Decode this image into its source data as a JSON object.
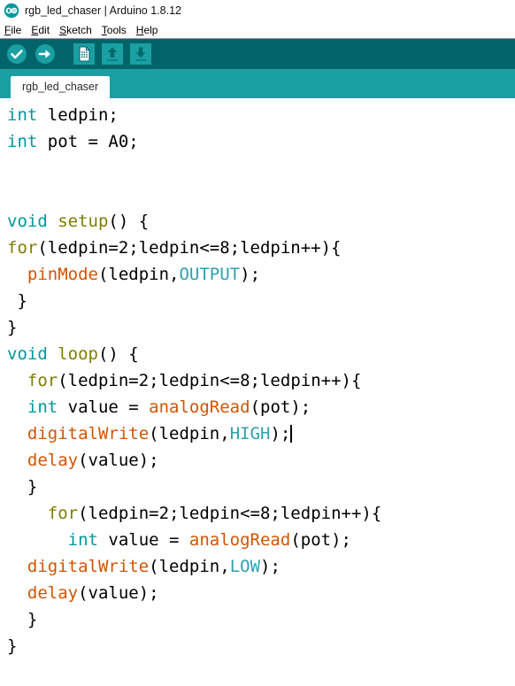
{
  "window": {
    "title": "rgb_led_chaser | Arduino 1.8.12",
    "logo_icon": "arduino-infinity-logo"
  },
  "menubar": {
    "items": [
      {
        "label": "File",
        "mnemonic": "F",
        "rest": "ile"
      },
      {
        "label": "Edit",
        "mnemonic": "E",
        "rest": "dit"
      },
      {
        "label": "Sketch",
        "mnemonic": "S",
        "rest": "ketch"
      },
      {
        "label": "Tools",
        "mnemonic": "T",
        "rest": "ools"
      },
      {
        "label": "Help",
        "mnemonic": "H",
        "rest": "elp"
      }
    ]
  },
  "toolbar": {
    "background": "#006468",
    "buttons": [
      {
        "name": "verify-button",
        "icon": "checkmark-icon",
        "tooltip": "Verify"
      },
      {
        "name": "upload-button",
        "icon": "arrow-right-icon",
        "tooltip": "Upload"
      },
      {
        "name": "new-button",
        "icon": "new-document-icon",
        "tooltip": "New"
      },
      {
        "name": "open-button",
        "icon": "arrow-up-icon",
        "tooltip": "Open"
      },
      {
        "name": "save-button",
        "icon": "arrow-down-icon",
        "tooltip": "Save"
      }
    ]
  },
  "tabbar": {
    "background": "#1a9fa3",
    "tabs": [
      {
        "label": "rgb_led_chaser",
        "active": true
      }
    ]
  },
  "editor": {
    "colors": {
      "type": "#00979c",
      "keyword": "#7e7e00",
      "function": "#d35400",
      "constant": "#2e9fb0",
      "plain": "#000000",
      "background": "#ffffff"
    },
    "caret_line": 13,
    "lines": [
      {
        "n": 1,
        "tokens": [
          {
            "t": "type",
            "v": "int"
          },
          {
            "t": "plain",
            "v": " ledpin;"
          }
        ]
      },
      {
        "n": 2,
        "tokens": [
          {
            "t": "type",
            "v": "int"
          },
          {
            "t": "plain",
            "v": " pot = A0;"
          }
        ]
      },
      {
        "n": 3,
        "tokens": []
      },
      {
        "n": 4,
        "tokens": []
      },
      {
        "n": 5,
        "tokens": [
          {
            "t": "type",
            "v": "void"
          },
          {
            "t": "plain",
            "v": " "
          },
          {
            "t": "fnname",
            "v": "setup"
          },
          {
            "t": "plain",
            "v": "() {"
          }
        ]
      },
      {
        "n": 6,
        "tokens": [
          {
            "t": "kw",
            "v": "for"
          },
          {
            "t": "plain",
            "v": "(ledpin=2;ledpin<=8;ledpin++){"
          }
        ]
      },
      {
        "n": 7,
        "tokens": [
          {
            "t": "plain",
            "v": "  "
          },
          {
            "t": "fn",
            "v": "pinMode"
          },
          {
            "t": "plain",
            "v": "(ledpin,"
          },
          {
            "t": "const",
            "v": "OUTPUT"
          },
          {
            "t": "plain",
            "v": ");"
          }
        ]
      },
      {
        "n": 8,
        "tokens": [
          {
            "t": "plain",
            "v": " }"
          }
        ]
      },
      {
        "n": 9,
        "tokens": [
          {
            "t": "plain",
            "v": "}"
          }
        ]
      },
      {
        "n": 10,
        "tokens": [
          {
            "t": "type",
            "v": "void"
          },
          {
            "t": "plain",
            "v": " "
          },
          {
            "t": "fnname",
            "v": "loop"
          },
          {
            "t": "plain",
            "v": "() {"
          }
        ]
      },
      {
        "n": 11,
        "tokens": [
          {
            "t": "plain",
            "v": "  "
          },
          {
            "t": "kw",
            "v": "for"
          },
          {
            "t": "plain",
            "v": "(ledpin=2;ledpin<=8;ledpin++){"
          }
        ]
      },
      {
        "n": 12,
        "tokens": [
          {
            "t": "plain",
            "v": "  "
          },
          {
            "t": "type",
            "v": "int"
          },
          {
            "t": "plain",
            "v": " value = "
          },
          {
            "t": "fn",
            "v": "analogRead"
          },
          {
            "t": "plain",
            "v": "(pot);"
          }
        ]
      },
      {
        "n": 13,
        "tokens": [
          {
            "t": "plain",
            "v": "  "
          },
          {
            "t": "fn",
            "v": "digitalWrite"
          },
          {
            "t": "plain",
            "v": "(ledpin,"
          },
          {
            "t": "const",
            "v": "HIGH"
          },
          {
            "t": "plain",
            "v": ");"
          }
        ]
      },
      {
        "n": 14,
        "tokens": [
          {
            "t": "plain",
            "v": "  "
          },
          {
            "t": "fn",
            "v": "delay"
          },
          {
            "t": "plain",
            "v": "(value);"
          }
        ]
      },
      {
        "n": 15,
        "tokens": [
          {
            "t": "plain",
            "v": "  }"
          }
        ]
      },
      {
        "n": 16,
        "tokens": [
          {
            "t": "plain",
            "v": "    "
          },
          {
            "t": "kw",
            "v": "for"
          },
          {
            "t": "plain",
            "v": "(ledpin=2;ledpin<=8;ledpin++){"
          }
        ]
      },
      {
        "n": 17,
        "tokens": [
          {
            "t": "plain",
            "v": "      "
          },
          {
            "t": "type",
            "v": "int"
          },
          {
            "t": "plain",
            "v": " value = "
          },
          {
            "t": "fn",
            "v": "analogRead"
          },
          {
            "t": "plain",
            "v": "(pot);"
          }
        ]
      },
      {
        "n": 18,
        "tokens": [
          {
            "t": "plain",
            "v": "  "
          },
          {
            "t": "fn",
            "v": "digitalWrite"
          },
          {
            "t": "plain",
            "v": "(ledpin,"
          },
          {
            "t": "const",
            "v": "LOW"
          },
          {
            "t": "plain",
            "v": ");"
          }
        ]
      },
      {
        "n": 19,
        "tokens": [
          {
            "t": "plain",
            "v": "  "
          },
          {
            "t": "fn",
            "v": "delay"
          },
          {
            "t": "plain",
            "v": "(value);"
          }
        ]
      },
      {
        "n": 20,
        "tokens": [
          {
            "t": "plain",
            "v": "  }"
          }
        ]
      },
      {
        "n": 21,
        "tokens": [
          {
            "t": "plain",
            "v": "}"
          }
        ]
      }
    ]
  }
}
